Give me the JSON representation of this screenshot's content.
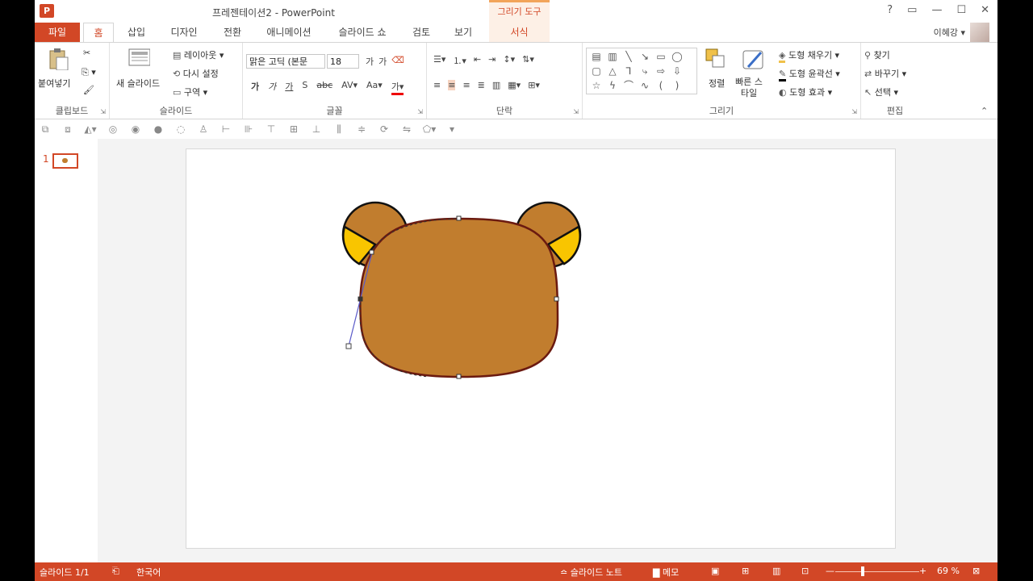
{
  "app": {
    "icon_text": "P",
    "window_title": "프레젠테이션2 - PowerPoint",
    "context_group": "그리기 도구"
  },
  "qat": [
    "💾",
    "↶",
    "↷",
    "▾"
  ],
  "window_controls": {
    "help": "?",
    "ribbon_opts": "▭",
    "minimize": "—",
    "maximize": "☐",
    "close": "✕"
  },
  "tabs": {
    "file": "파일",
    "home": "홈",
    "insert": "삽입",
    "design": "디자인",
    "transitions": "전환",
    "animations": "애니메이션",
    "slideshow": "슬라이드 쇼",
    "review": "검토",
    "view": "보기",
    "format": "서식"
  },
  "user": {
    "name": "이혜강 ▾"
  },
  "ribbon": {
    "clipboard": {
      "label": "클립보드",
      "paste": "붙여넣기"
    },
    "slides": {
      "label": "슬라이드",
      "new_slide": "새 슬라이드",
      "layout": "레이아웃 ▾",
      "reset": "다시 설정",
      "section": "구역 ▾"
    },
    "font": {
      "label": "글꼴",
      "font_name": "맑은 고딕 (본문",
      "font_size": "18"
    },
    "paragraph": {
      "label": "단락"
    },
    "drawing": {
      "label": "그리기",
      "arrange": "정렬",
      "quick_styles": "빠른 스타일",
      "shape_fill": "도형 채우기 ▾",
      "shape_outline": "도형 윤곽선 ▾",
      "shape_effects": "도형 효과 ▾"
    },
    "editing": {
      "label": "편집",
      "find": "찾기",
      "replace": "바꾸기 ▾",
      "select": "선택 ▾"
    }
  },
  "slides_pane": {
    "slide_number": "1"
  },
  "colors": {
    "accent": "#d24726",
    "bear_fur": "#c17d2e",
    "ear_inner": "#f9c500",
    "outline": "#6b1a10"
  },
  "status": {
    "slide_info": "슬라이드 1/1",
    "language": "한국어",
    "notes": "슬라이드 노트",
    "comments": "메모",
    "zoom": "69 %",
    "minus": "—",
    "plus": "+"
  }
}
